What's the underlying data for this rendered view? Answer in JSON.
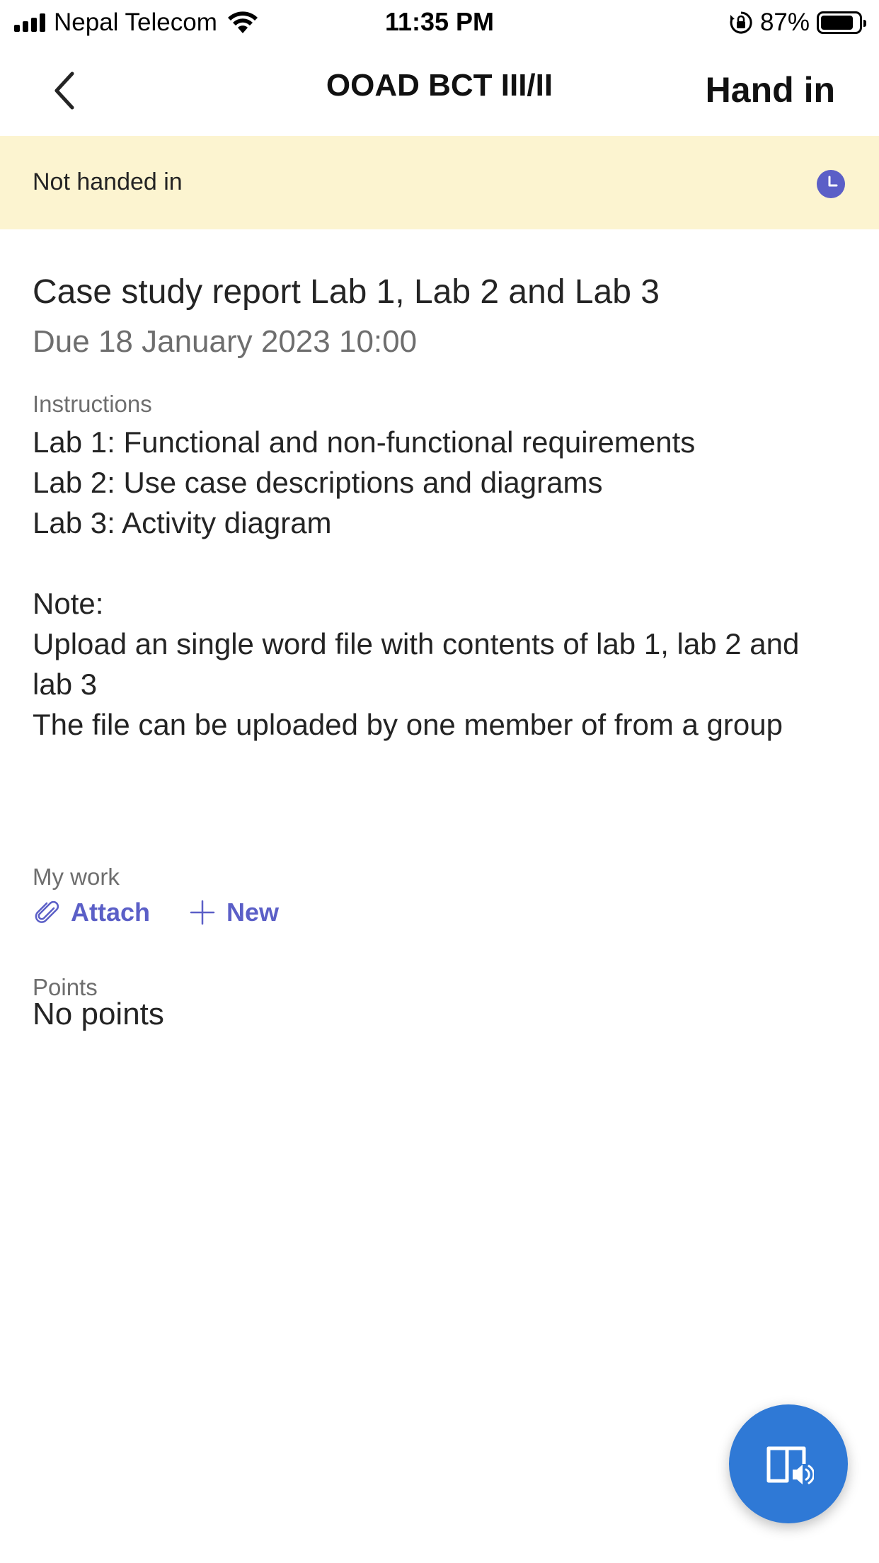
{
  "status_bar": {
    "carrier": "Nepal Telecom",
    "time": "11:35 PM",
    "battery_percent": "87%",
    "battery_level": 0.87
  },
  "header": {
    "title": "OOAD BCT III/II",
    "hand_in_label": "Hand in",
    "back_icon": "chevron-left-icon"
  },
  "banner": {
    "status_text": "Not handed in",
    "badge_icon": "clock-icon",
    "badge_color": "#5b5fc7",
    "background_color": "#fcf4d0"
  },
  "assignment": {
    "title": "Case study report Lab 1, Lab 2 and Lab 3",
    "due": "Due 18 January 2023 10:00",
    "instructions_label": "Instructions",
    "instructions": [
      "Lab 1: Functional and non-functional requirements",
      "Lab 2: Use case descriptions and diagrams",
      "Lab 3: Activity diagram",
      "",
      "Note:",
      "Upload an single word file with contents of lab 1, lab 2 and lab 3",
      "The file can be uploaded by one member of from a group"
    ]
  },
  "my_work": {
    "label": "My work",
    "attach_label": "Attach",
    "new_label": "New",
    "accent_color": "#5b5fc7"
  },
  "points": {
    "label": "Points",
    "value": "No points"
  },
  "fab": {
    "icon": "immersive-reader-icon",
    "color": "#2f79d6"
  }
}
